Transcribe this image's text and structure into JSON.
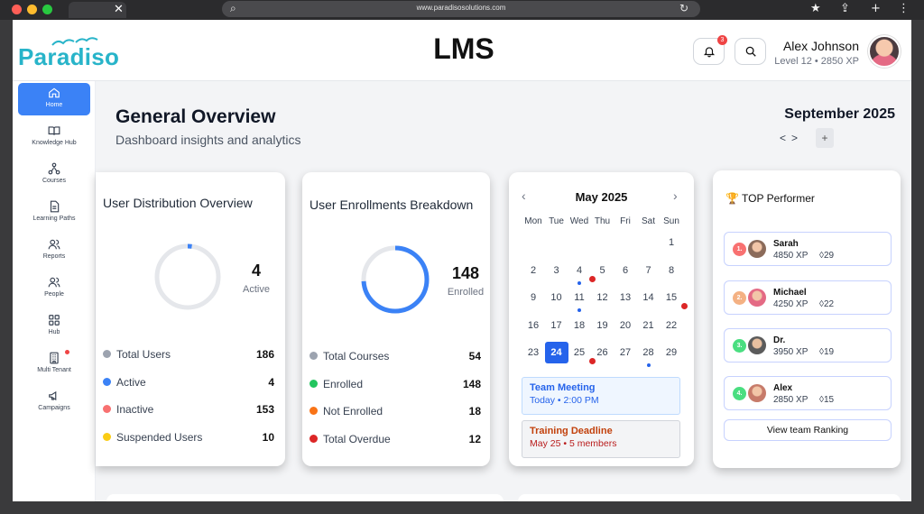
{
  "browser": {
    "url": "www.paradisosolutions.com",
    "traffic_lights": [
      "#ff5f57",
      "#febc2e",
      "#28c840"
    ]
  },
  "header": {
    "logo": "Paradiso",
    "title": "LMS",
    "notification_count": "3",
    "user_name": "Alex Johnson",
    "user_level": "Level 12 • 2850 XP"
  },
  "sidebar": {
    "items": [
      {
        "label": "Home",
        "icon": "home-icon",
        "active": true
      },
      {
        "label": "Knowledge Hub",
        "icon": "book-icon"
      },
      {
        "label": "Courses",
        "icon": "network-icon"
      },
      {
        "label": "Learning Paths",
        "icon": "document-icon"
      },
      {
        "label": "Reports",
        "icon": "users-icon"
      },
      {
        "label": "People",
        "icon": "people-icon"
      },
      {
        "label": "Hub",
        "icon": "grid-icon"
      },
      {
        "label": "Multi Tenant",
        "icon": "building-icon"
      },
      {
        "label": "Campaigns",
        "icon": "megaphone-icon"
      }
    ]
  },
  "overview": {
    "title": "General Overview",
    "subtitle": "Dashboard insights and analytics",
    "month": "September 2025",
    "prev": "<",
    "next": ">",
    "add": "+"
  },
  "user_distribution": {
    "title": "User Distribution Overview",
    "ring_value": "4",
    "ring_label": "Active",
    "ring_fraction": 0.0215,
    "rows": [
      {
        "label": "Total Users",
        "value": "186",
        "color": "#9ca3af"
      },
      {
        "label": "Active",
        "value": "4",
        "color": "#3b82f6"
      },
      {
        "label": "Inactive",
        "value": "153",
        "color": "#f87171"
      },
      {
        "label": "Suspended Users",
        "value": "10",
        "color": "#facc15"
      }
    ]
  },
  "enrollments": {
    "title": "User Enrollments Breakdown",
    "ring_value": "148",
    "ring_label": "Enrolled",
    "ring_fraction": 0.74,
    "rows": [
      {
        "label": "Total Courses",
        "value": "54",
        "color": "#9ca3af"
      },
      {
        "label": "Enrolled",
        "value": "148",
        "color": "#22c55e"
      },
      {
        "label": "Not Enrolled",
        "value": "18",
        "color": "#f97316"
      },
      {
        "label": "Total Overdue",
        "value": "12",
        "color": "#dc2626"
      }
    ]
  },
  "calendar": {
    "month": "May 2025",
    "prev": "‹",
    "next": "›",
    "weekdays": [
      "Mon",
      "Tue",
      "Wed",
      "Thu",
      "Fri",
      "Sat",
      "Sun"
    ],
    "first_weekday_index": 6,
    "days_in_month": 31,
    "selected_day": 24,
    "red_dot_days": [
      4,
      15,
      25
    ],
    "blue_dot_days": [
      4,
      11,
      28
    ],
    "events": [
      {
        "title": "Team Meeting",
        "detail": "Today • 2:00 PM"
      },
      {
        "title": "Training Deadline",
        "detail": "May 25 • 5 members"
      }
    ]
  },
  "performers": {
    "title": "TOP Performer",
    "list": [
      {
        "rank": "1.",
        "name": "Sarah",
        "xp": "4850 XP",
        "streak": "29",
        "rank_color": "#f87171"
      },
      {
        "rank": "2.",
        "name": "Michael",
        "xp": "4250 XP",
        "streak": "22",
        "rank_color": "#f4b183"
      },
      {
        "rank": "3.",
        "name": "Dr.",
        "xp": "3950 XP",
        "streak": "19",
        "rank_color": "#4ade80"
      },
      {
        "rank": "4.",
        "name": "Alex",
        "xp": "2850 XP",
        "streak": "15",
        "rank_color": "#4ade80"
      }
    ],
    "ranking_button": "View team Ranking"
  }
}
